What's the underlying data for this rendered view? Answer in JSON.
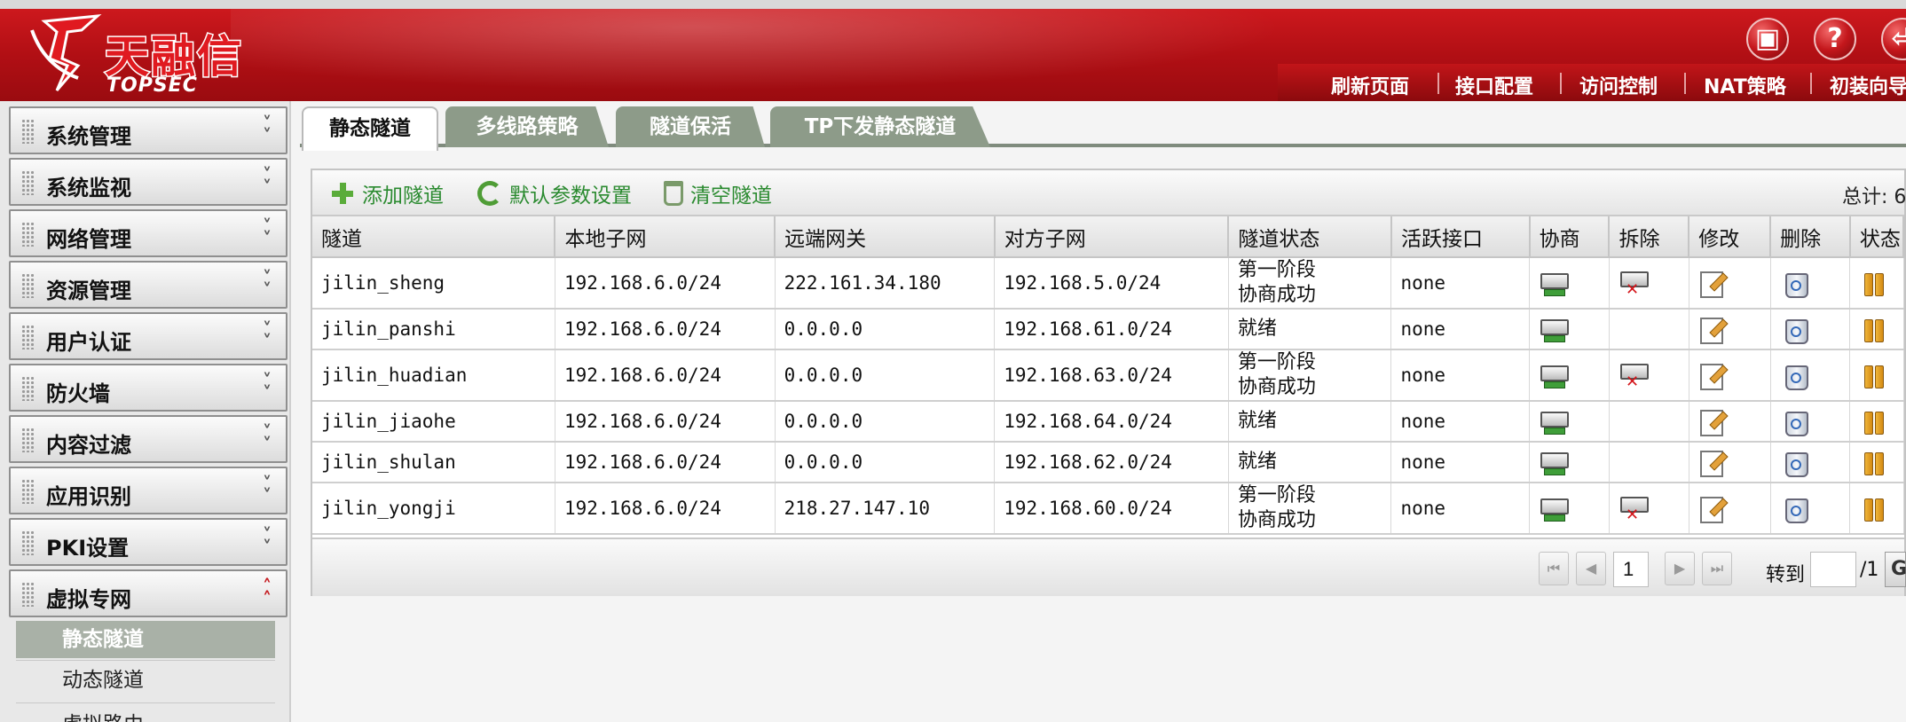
{
  "header": {
    "brand_cn": "天融信",
    "brand_en": "TOPSEC",
    "icons": [
      "save-icon",
      "help-icon",
      "logout-icon"
    ],
    "nav": [
      "刷新页面",
      "接口配置",
      "访问控制",
      "NAT策略",
      "初装向导"
    ]
  },
  "sidebar": {
    "items": [
      {
        "label": "系统管理"
      },
      {
        "label": "系统监视"
      },
      {
        "label": "网络管理"
      },
      {
        "label": "资源管理"
      },
      {
        "label": "用户认证"
      },
      {
        "label": "防火墙"
      },
      {
        "label": "内容过滤"
      },
      {
        "label": "应用识别"
      },
      {
        "label": "PKI设置"
      },
      {
        "label": "虚拟专网"
      }
    ],
    "subitems": [
      {
        "label": "静态隧道"
      },
      {
        "label": "动态隧道"
      },
      {
        "label": "虚拟路由"
      }
    ]
  },
  "tabs": [
    "静态隧道",
    "多线路策略",
    "隧道保活",
    "TP下发静态隧道"
  ],
  "toolbar": {
    "add": "添加隧道",
    "defaults": "默认参数设置",
    "clear": "清空隧道",
    "total_label": "总计: 6"
  },
  "table": {
    "columns": [
      "隧道",
      "本地子网",
      "远端网关",
      "对方子网",
      "隧道状态",
      "活跃接口",
      "协商",
      "拆除",
      "修改",
      "删除",
      "状态"
    ],
    "rows": [
      {
        "name": "jilin_sheng",
        "local": "192.168.6.0/24",
        "gateway": "222.161.34.180",
        "remote": "192.168.5.0/24",
        "status_line1": "第一阶段",
        "status_line2": "协商成功",
        "iface": "none",
        "teardown": true
      },
      {
        "name": "jilin_panshi",
        "local": "192.168.6.0/24",
        "gateway": "0.0.0.0",
        "remote": "192.168.61.0/24",
        "status_line1": "就绪",
        "status_line2": "",
        "iface": "none",
        "teardown": false
      },
      {
        "name": "jilin_huadian",
        "local": "192.168.6.0/24",
        "gateway": "0.0.0.0",
        "remote": "192.168.63.0/24",
        "status_line1": "第一阶段",
        "status_line2": "协商成功",
        "iface": "none",
        "teardown": true
      },
      {
        "name": "jilin_jiaohe",
        "local": "192.168.6.0/24",
        "gateway": "0.0.0.0",
        "remote": "192.168.64.0/24",
        "status_line1": "就绪",
        "status_line2": "",
        "iface": "none",
        "teardown": false
      },
      {
        "name": "jilin_shulan",
        "local": "192.168.6.0/24",
        "gateway": "0.0.0.0",
        "remote": "192.168.62.0/24",
        "status_line1": "就绪",
        "status_line2": "",
        "iface": "none",
        "teardown": false
      },
      {
        "name": "jilin_yongji",
        "local": "192.168.6.0/24",
        "gateway": "218.27.147.10",
        "remote": "192.168.60.0/24",
        "status_line1": "第一阶段",
        "status_line2": "协商成功",
        "iface": "none",
        "teardown": true
      }
    ]
  },
  "pager": {
    "page": "1",
    "goto_label": "转到",
    "total_pages": "/1",
    "go_label": "G"
  },
  "colors": {
    "header_red": "#c4171c",
    "tab_gray_green": "#8d9b89",
    "toolbar_green": "#2a8a2f"
  }
}
